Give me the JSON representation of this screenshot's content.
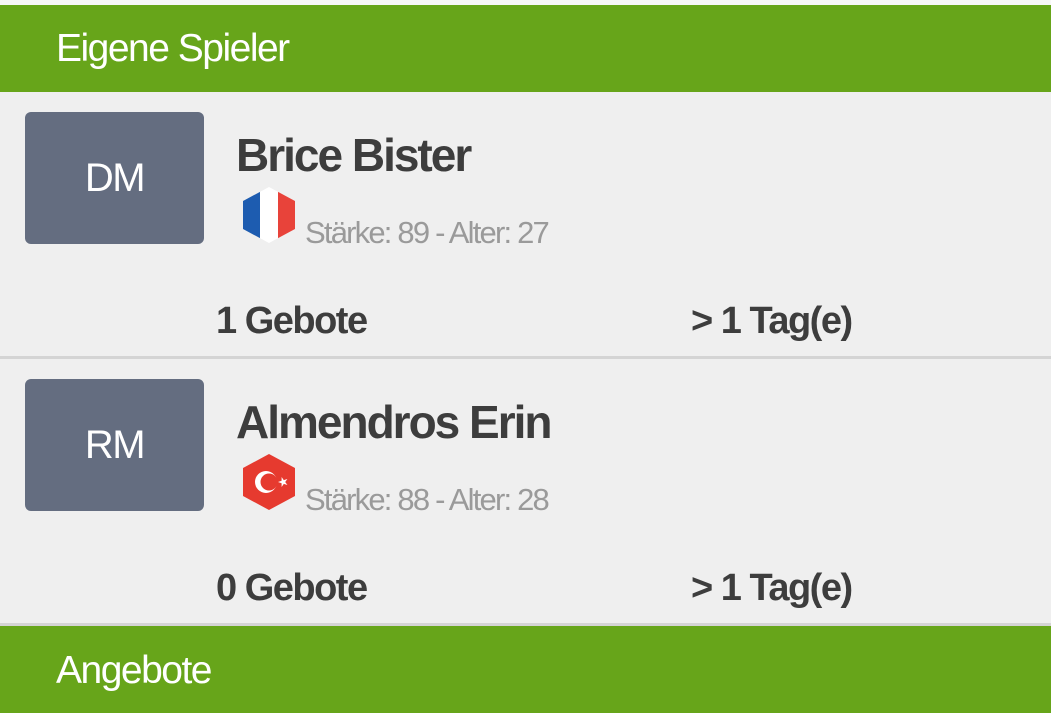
{
  "sections": {
    "own_players": "Eigene Spieler",
    "offers": "Angebote"
  },
  "players": [
    {
      "position": "DM",
      "name": "Brice Bister",
      "flag": "france-flag-icon",
      "stats": "Stärke: 89 - Alter: 27",
      "bids": "1 Gebote",
      "time_left": "> 1 Tag(e)"
    },
    {
      "position": "RM",
      "name": "Almendros Erin",
      "flag": "turkey-flag-icon",
      "stats": "Stärke: 88 - Alter: 28",
      "bids": "0 Gebote",
      "time_left": "> 1 Tag(e)"
    }
  ],
  "colors": {
    "header_bg": "#67a51a",
    "badge_bg": "#646d80",
    "card_bg": "#efefef",
    "france_blue": "#1d5cb0",
    "france_red": "#e8433a",
    "turkey_red": "#e63a2f"
  }
}
